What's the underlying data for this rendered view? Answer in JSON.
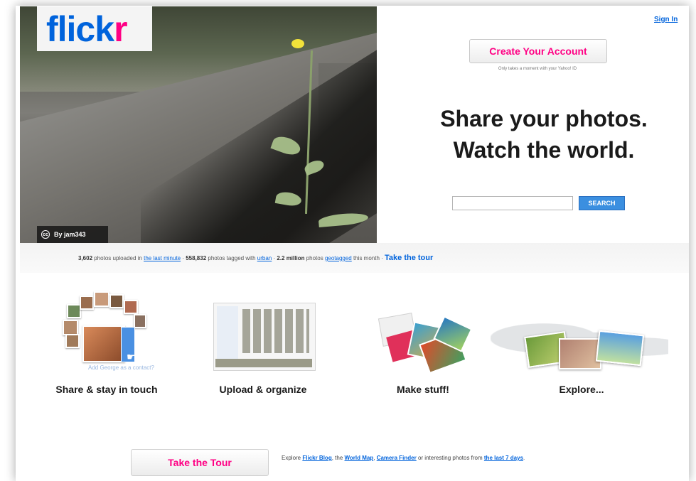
{
  "header": {
    "logo_part1": "flick",
    "logo_part2": "r",
    "sign_in": "Sign In"
  },
  "hero": {
    "photo_credit": "By jam343"
  },
  "signup": {
    "create_button": "Create Your Account",
    "subtext": "Only takes a moment with your Yahoo! ID"
  },
  "headline": {
    "line1": "Share your photos.",
    "line2": "Watch the world."
  },
  "search": {
    "placeholder": "",
    "button": "SEARCH"
  },
  "stats": {
    "uploaded_count": "3,602",
    "uploaded_text": " photos uploaded in ",
    "uploaded_link": "the last minute",
    "sep1": " · ",
    "tagged_count": "558,832",
    "tagged_text": " photos tagged with ",
    "tagged_link": "urban",
    "sep2": " · ",
    "geo_count": "2.2 million",
    "geo_text": " photos ",
    "geo_link": "geotagged",
    "geo_tail": " this month · ",
    "tour_link": "Take the tour"
  },
  "features": [
    {
      "title": "Share & stay in touch",
      "caption": "Add George as a contact?"
    },
    {
      "title": "Upload & organize"
    },
    {
      "title": "Make stuff!"
    },
    {
      "title": "Explore..."
    }
  ],
  "footer": {
    "tour_button": "Take the Tour",
    "explore_prefix": "Explore ",
    "blog_link": "Flickr Blog",
    "sep_a": ", the ",
    "map_link": "World Map",
    "sep_b": ", ",
    "camera_link": "Camera Finder",
    "sep_c": " or interesting photos from ",
    "last7_link": "the last 7 days",
    "tail": "."
  },
  "colors": {
    "brand_blue": "#0063dc",
    "brand_pink": "#ff0084"
  }
}
